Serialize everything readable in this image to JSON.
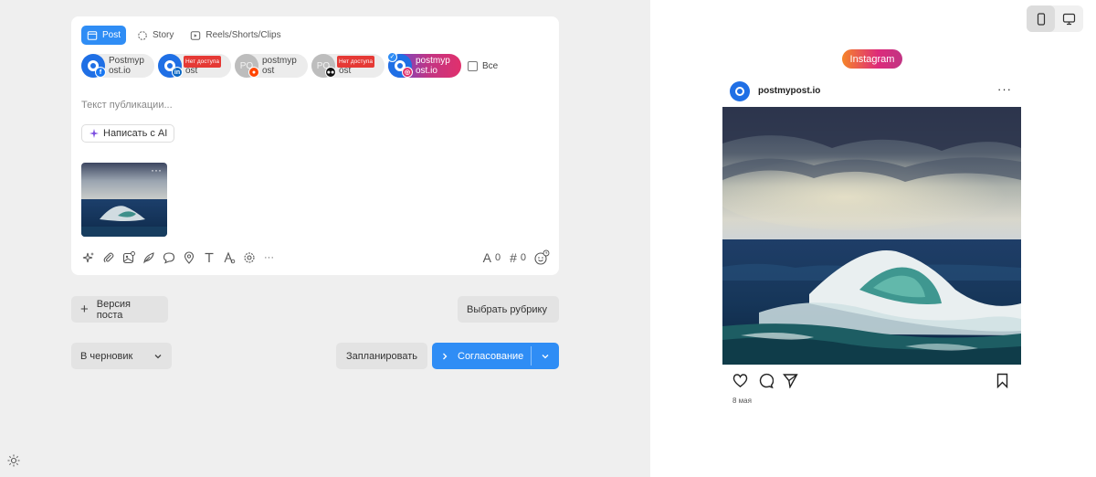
{
  "editor": {
    "tabs": [
      {
        "label": "Post",
        "icon": "window-icon",
        "active": true
      },
      {
        "label": "Story",
        "icon": "story-circle-icon",
        "active": false
      },
      {
        "label": "Reels/Shorts/Clips",
        "icon": "video-icon",
        "active": false
      }
    ],
    "accounts": [
      {
        "line1": "Postmyp",
        "line2": "ost.io",
        "network": "facebook",
        "network_color": "#1877f2",
        "badge": ""
      },
      {
        "line1": "Po",
        "line2": "ost",
        "network": "linkedin",
        "network_color": "#0a66c2",
        "badge": "Нет доступа"
      },
      {
        "line1": "postmyp",
        "line2": "ost",
        "network": "reddit",
        "network_color": "#ff4500",
        "badge": "",
        "avatar_initials": "PO"
      },
      {
        "line1": "Po",
        "line2": "ost",
        "network": "medium",
        "network_color": "#111111",
        "badge": "Нет доступа",
        "avatar_initials": "PO"
      },
      {
        "line1": "postmyp",
        "line2": "ost.io",
        "network": "instagram",
        "network_color": "#e1306c",
        "badge": "",
        "selected": true
      }
    ],
    "select_all_label": "Все",
    "text_placeholder": "Текст публикации...",
    "ai_button_label": "Написать с AI",
    "thumb_menu": "···",
    "more_tools": "···",
    "char_count": "0",
    "hashtag_count": "0"
  },
  "actions": {
    "version_label": "Версия поста",
    "rubric_label": "Выбрать рубрику",
    "draft_label": "В черновик",
    "schedule_label": "Запланировать",
    "approve_label": "Согласование"
  },
  "preview": {
    "network_badge": "Instagram",
    "account_name": "postmyp​ost.io",
    "more": "···",
    "date": "8 мая"
  },
  "colors": {
    "accent": "#2f8df5",
    "badge_red": "#e53935"
  }
}
